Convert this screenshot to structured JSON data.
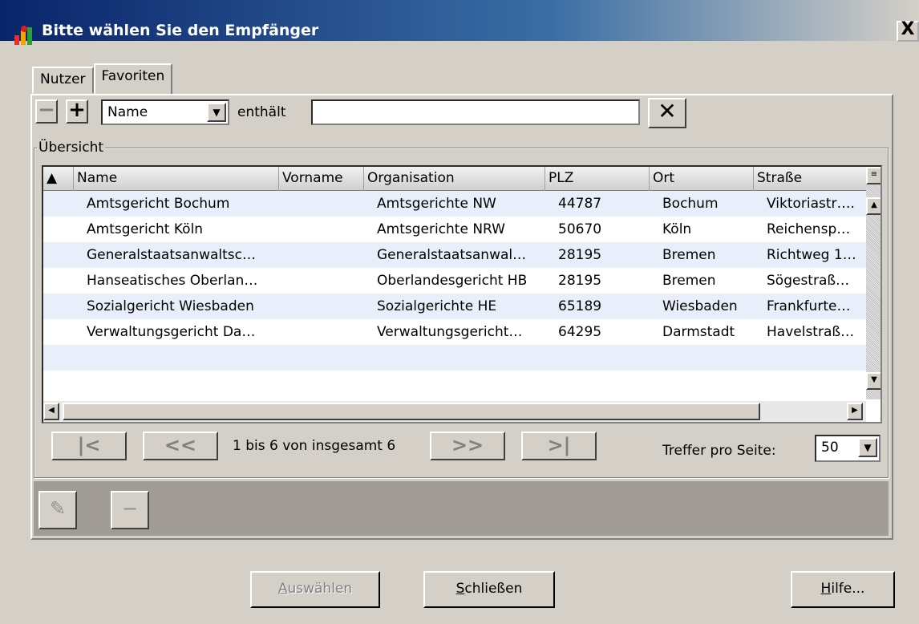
{
  "window": {
    "title": "Bitte wählen Sie den Empfänger",
    "close_label": "X"
  },
  "tabs": [
    {
      "label": "Nutzer",
      "active": false
    },
    {
      "label": "Favoriten",
      "active": true
    }
  ],
  "filter": {
    "minus_label": "−",
    "plus_label": "+",
    "field_value": "Name",
    "contains_label": "enthält",
    "search_value": "",
    "clear_label": "✕"
  },
  "overview": {
    "legend": "Übersicht",
    "columns": [
      "Name",
      "Vorname",
      "Organisation",
      "PLZ",
      "Ort",
      "Straße"
    ],
    "rows": [
      [
        "Amtsgericht Bochum",
        "",
        "Amtsgerichte NW",
        "44787",
        "Bochum",
        "Viktoriastr…."
      ],
      [
        "Amtsgericht Köln",
        "",
        "Amtsgerichte NRW",
        "50670",
        "Köln",
        "Reichensp…"
      ],
      [
        "Generalstaatsanwaltsc…",
        "",
        "Generalstaatsanwal…",
        "28195",
        "Bremen",
        "Richtweg 1…"
      ],
      [
        "Hanseatisches Oberlan…",
        "",
        "Oberlandesgericht HB",
        "28195",
        "Bremen",
        "Sögestraß…"
      ],
      [
        "Sozialgericht Wiesbaden",
        "",
        "Sozialgerichte HE",
        "65189",
        "Wiesbaden",
        "Frankfurte…"
      ],
      [
        "Verwaltungsgericht Da…",
        "",
        "Verwaltungsgericht…",
        "64295",
        "Darmstadt",
        "Havelstraß…"
      ]
    ]
  },
  "pager": {
    "first": "|<",
    "prev": "<<",
    "status": "1 bis 6 von insgesamt 6",
    "next": ">>",
    "last": ">|",
    "per_page_label": "Treffer pro Seite:",
    "per_page_value": "50"
  },
  "buttons": {
    "select_key": "A",
    "select_rest": "uswählen",
    "close_key": "S",
    "close_rest": "chließen",
    "help_key": "H",
    "help_rest": "ilfe..."
  }
}
